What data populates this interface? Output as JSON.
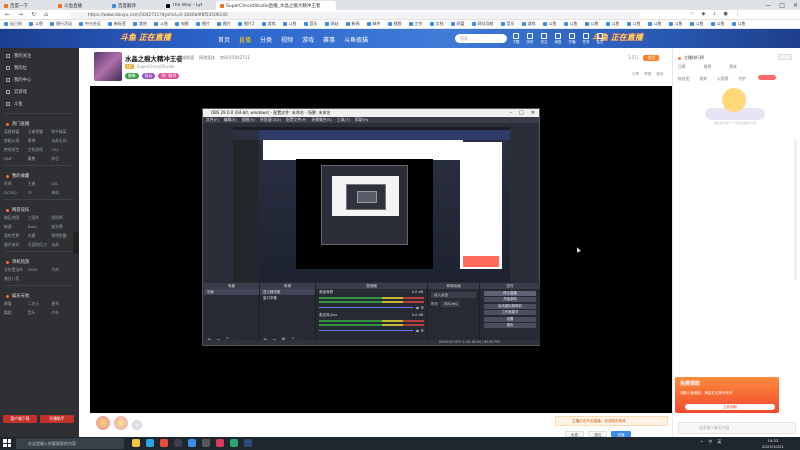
{
  "browser": {
    "tabs": [
      {
        "label": "百度一下"
      },
      {
        "label": "斗鱼直播"
      },
      {
        "label": "百度翻译"
      },
      {
        "label": "The Way - Lyt"
      },
      {
        "label": "SuperChrontStudio直播_水晶之痕大精冲王者",
        "active": true
      }
    ],
    "url": "https://www.douyu.com/5042711?dyshid=0-3040b9f8f53506240",
    "bookmarks": [
      "自己的",
      "斗鱼",
      "银行活动",
      "中古社区",
      "新标签",
      "其他",
      "斗鱼",
      "电影",
      "图片",
      "图片",
      "图片2",
      "游戏",
      "斗鱼",
      "音乐",
      "网站",
      "新闻",
      "邮件",
      "视频",
      "工作",
      "文档",
      "网盘",
      "网址导航",
      "音乐",
      "游戏",
      "斗鱼",
      "斗鱼",
      "斗鱼",
      "斗鱼",
      "斗鱼",
      "斗鱼",
      "斗鱼",
      "斗鱼",
      "斗鱼",
      "斗鱼"
    ]
  },
  "site": {
    "logo": "斗鱼 正在直播",
    "nav": [
      "首页",
      "直播",
      "分类",
      "视频",
      "游戏",
      "赛事",
      "斗鱼夜猫"
    ],
    "nav_active": 1,
    "search_placeholder": "搜索",
    "header_icons": [
      "下载",
      "历史",
      "关注",
      "消息",
      "开播",
      "任务",
      "会员"
    ]
  },
  "sidebar": {
    "main": [
      "我的关注",
      "我的位",
      "我的中心",
      "云游戏",
      "斗鱼"
    ],
    "sections": [
      {
        "title": "热门直播",
        "items": [
          "英雄联盟",
          "王者荣耀",
          "和平精英",
          "穿越火线",
          "原神",
          "永劫无间",
          "绝地求生",
          "主机游戏",
          "CS2",
          "DNF",
          "魔兽",
          "炉石"
        ]
      },
      {
        "title": "我的收藏",
        "items": [
          "吃鸡",
          "王者",
          "LOL",
          "DOTA2",
          "CF",
          "单机"
        ]
      },
      {
        "title": "网游竞技",
        "items": [
          "暗区突围",
          "三国杀",
          "阴阳师",
          "新游",
          "Dota",
          "逆水寒",
          "我的世界",
          "光遇",
          "黎明觉醒",
          "蛋仔派对",
          "天涯明月刀",
          "永劫"
        ]
      },
      {
        "title": "单机热游",
        "items": [
          "艾尔登法环",
          "GTA5",
          "方舟",
          "鬼谷八荒"
        ]
      },
      {
        "title": "娱乐天地",
        "items": [
          "颜值",
          "二次元",
          "星秀",
          "舞蹈",
          "音乐",
          "户外"
        ]
      }
    ],
    "bottom_buttons": [
      "客户端下载",
      "开播助手"
    ]
  },
  "room": {
    "title": "水晶之痕大精冲王者",
    "category": [
      "英雄联盟",
      "网游竞技",
      "房间号5042711"
    ],
    "level": "LV",
    "owner": "SuperChrontStudio",
    "tags": [
      {
        "label": "巅峰",
        "color": "green"
      },
      {
        "label": "陪玩",
        "color": "purple"
      },
      {
        "label": "热门推荐",
        "color": "pink"
      }
    ],
    "follows": "3.5万",
    "follow_label": "关注",
    "icons": [
      "分享",
      "举报",
      "投诉"
    ]
  },
  "obs": {
    "title": "OBS 29.0.0 (64-bit, windows) - 配置文件: 未命名 - 场景: 未命名",
    "menu": [
      "文件(F)",
      "编辑(E)",
      "视图(V)",
      "停靠窗口(D)",
      "配置文件(P)",
      "场景集合(S)",
      "工具(T)",
      "帮助(H)"
    ],
    "docks": {
      "scenes": {
        "title": "场景",
        "items": [
          "场景"
        ]
      },
      "sources": {
        "title": "来源",
        "items": [
          "显示器采集",
          "窗口采集"
        ]
      },
      "mixer": {
        "title": "混音器",
        "channels": [
          {
            "name": "桌面音频",
            "value": "0.0 dB"
          },
          {
            "name": "麦克风/Aux",
            "value": "0.0 dB"
          }
        ]
      },
      "transitions": {
        "title": "转场动画",
        "value": "淡入淡出",
        "duration_label": "时长",
        "duration": "300 ms"
      },
      "controls": {
        "title": "控件",
        "buttons": [
          "停止直播",
          "开始录制",
          "启动虚拟摄像机",
          "工作室模式",
          "设置",
          "退出"
        ]
      }
    },
    "status": "00:00:00   CPU: 2.4%   60.00 / 60.00 FPS"
  },
  "bottombar": {
    "banner": "主播正在开启直播，欢迎您的到来",
    "buttons": [
      "免费",
      "赠送",
      "充值"
    ]
  },
  "rightpanel": {
    "title": "主播排行榜",
    "tabs": [
      "日榜",
      "周榜",
      "贵宾"
    ],
    "subtabs": [
      "粉丝团",
      "贵宾",
      "火箭榜",
      "守护"
    ],
    "empty_text": "快来成为第一个守护主播的人吧~",
    "promo": {
      "title": "免费领取",
      "line": "领取斗鱼福利，海量礼包等你来拿",
      "button": "立即领取"
    },
    "chat_placeholder": "这里输入聊天内容"
  },
  "taskbar": {
    "search_placeholder": "在这里输入你要搜索的内容",
    "apps": [
      {
        "name": "file-explorer",
        "color": "#f6c443"
      },
      {
        "name": "edge",
        "color": "#2fa3e6"
      },
      {
        "name": "chrome",
        "color": "#e94b3c"
      },
      {
        "name": "terminal",
        "color": "#3a3f49"
      },
      {
        "name": "store",
        "color": "#3a8ee6"
      },
      {
        "name": "obs",
        "color": "#56585e"
      },
      {
        "name": "music",
        "color": "#d93c5b"
      },
      {
        "name": "video",
        "color": "#2aa876"
      },
      {
        "name": "steam",
        "color": "#2a4a7c"
      }
    ],
    "tray": [
      "^",
      "中",
      "英"
    ],
    "time": "14:22",
    "date": "2023/10/21"
  }
}
